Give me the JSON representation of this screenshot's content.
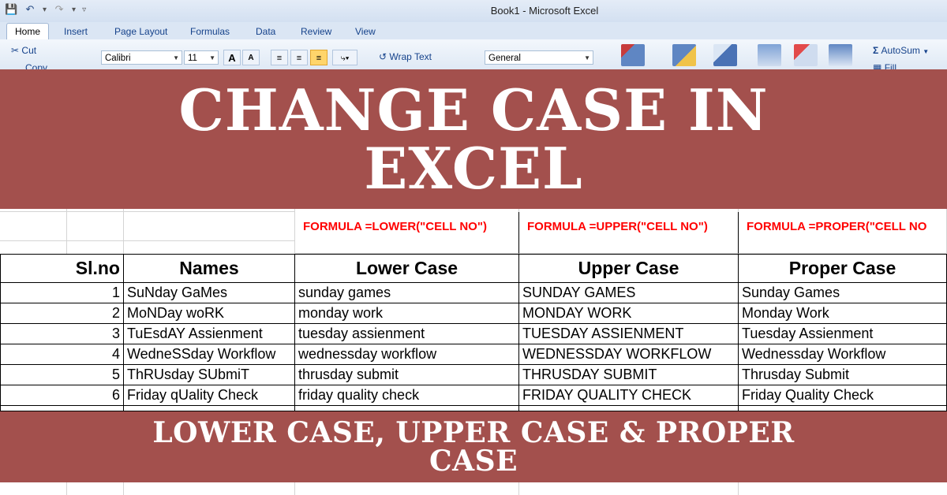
{
  "window": {
    "title": "Book1 - Microsoft Excel"
  },
  "ribbon": {
    "tabs": [
      "Home",
      "Insert",
      "Page Layout",
      "Formulas",
      "Data",
      "Review",
      "View"
    ],
    "clipboard": {
      "cut": "Cut",
      "copy": "Copy"
    },
    "font": {
      "name": "Calibri",
      "size": "11",
      "grow": "A",
      "shrink": "A"
    },
    "wrap_text": "Wrap Text",
    "number_format": "General",
    "editing": {
      "autosum": "AutoSum",
      "fill": "Fill"
    }
  },
  "banner_top": {
    "line1": "CHANGE CASE IN",
    "line2": "EXCEL"
  },
  "banner_bottom": {
    "line1": "LOWER CASE, UPPER CASE & PROPER",
    "line2": "CASE"
  },
  "sheet": {
    "formulas": {
      "lower": "FORMULA =LOWER(\"CELL NO\")",
      "upper": "FORMULA =UPPER(\"CELL NO\")",
      "proper": "FORMULA =PROPER(\"CELL NO"
    },
    "headers": [
      "Sl.no",
      "Names",
      "Lower Case",
      "Upper Case",
      "Proper Case"
    ],
    "rows": [
      [
        "1",
        "SuNday GaMes",
        "sunday games",
        "SUNDAY GAMES",
        "Sunday Games"
      ],
      [
        "2",
        "MoNDay woRK",
        "monday work",
        "MONDAY WORK",
        "Monday Work"
      ],
      [
        "3",
        "TuEsdAY Assienment",
        "tuesday assienment",
        "TUESDAY ASSIENMENT",
        "Tuesday Assienment"
      ],
      [
        "4",
        "WedneSSday Workflow",
        "wednessday workflow",
        "WEDNESSDAY WORKFLOW",
        "Wednessday Workflow"
      ],
      [
        "5",
        "ThRUsday SUbmiT",
        "thrusday submit",
        "THRUSDAY SUBMIT",
        "Thrusday Submit"
      ],
      [
        "6",
        "Friday qUality Check",
        "friday quality check",
        "FRIDAY QUALITY CHECK",
        "Friday Quality Check"
      ]
    ]
  },
  "colors": {
    "banner": "#a3504d",
    "formula": "#ff0000",
    "ribbon": "#dbe6f4"
  }
}
